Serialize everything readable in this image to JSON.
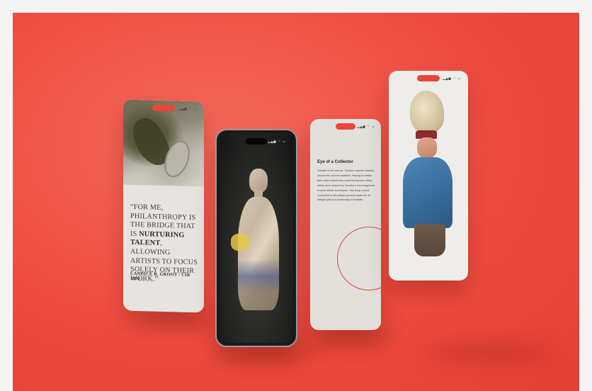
{
  "colors": {
    "background": "#ee4c3f",
    "screen_light": "#e6e4e0",
    "accent_ring": "#d94b3c"
  },
  "phone1": {
    "quote_open": "“For me, philanthropy is the bridge that is",
    "quote_emphasis": "nurturing talent",
    "quote_close": ", allowing artists to focus solely on their work.”",
    "credit": "Candice B. Groot / CIR 1990"
  },
  "phone3": {
    "title": "Eye of a Collector",
    "paragraph": "Outside of her own art, Candice inspired creators around her, and her students, helping to realize their vision before they could themselves. Many artists were inspired by Candice's encouragement to push artistic boundaries. This deep-rooted connection to the artistic process made her an integral part of a community of creators."
  }
}
